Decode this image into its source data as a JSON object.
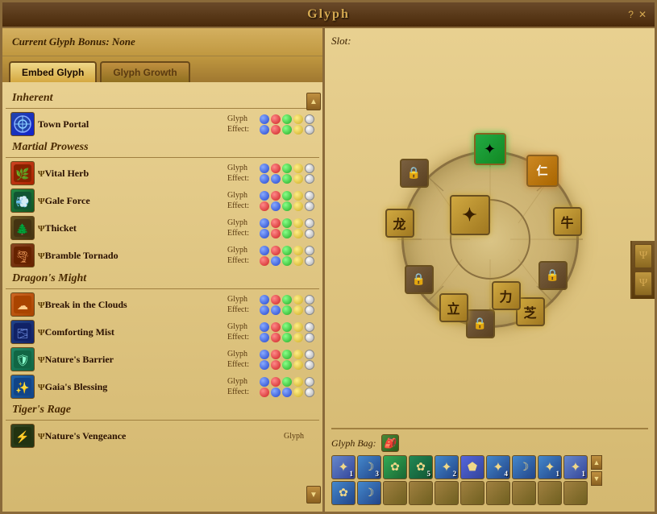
{
  "window": {
    "title": "Glyph",
    "help_btn": "?",
    "close_btn": "✕"
  },
  "header": {
    "bonus_label": "Current Glyph Bonus:",
    "bonus_value": "None",
    "embed_tab": "Embed Glyph",
    "growth_tab": "Glyph Growth"
  },
  "slot_label": "Slot:",
  "bag_label": "Glyph Bag:",
  "sections": [
    {
      "name": "Inherent",
      "items": [
        {
          "name": "Town Portal",
          "icon_class": "icon-town-portal",
          "icon_char": "🌀",
          "psi": false
        }
      ]
    },
    {
      "name": "Martial Prowess",
      "items": [
        {
          "name": "Vital Herb",
          "icon_class": "icon-vital-herb",
          "icon_char": "🌿",
          "psi": true
        },
        {
          "name": "Gale Force",
          "icon_class": "icon-gale-force",
          "icon_char": "💨",
          "psi": true
        },
        {
          "name": "Thicket",
          "icon_class": "icon-thicket",
          "icon_char": "🌲",
          "psi": true
        },
        {
          "name": "Bramble Tornado",
          "icon_class": "icon-bramble",
          "icon_char": "🌪",
          "psi": true
        }
      ]
    },
    {
      "name": "Dragon's Might",
      "items": [
        {
          "name": "Break in the Clouds",
          "icon_class": "icon-break",
          "icon_char": "☁",
          "psi": true
        },
        {
          "name": "Comforting Mist",
          "icon_class": "icon-comforting",
          "icon_char": "🌫",
          "psi": true
        },
        {
          "name": "Nature's Barrier",
          "icon_class": "icon-barrier",
          "icon_char": "🛡",
          "psi": true
        },
        {
          "name": "Gaia's Blessing",
          "icon_class": "icon-gaia",
          "icon_char": "✨",
          "psi": true
        }
      ]
    },
    {
      "name": "Tiger's Rage",
      "items": [
        {
          "name": "Nature's Vengeance",
          "icon_class": "icon-nature-veng",
          "icon_char": "⚡",
          "psi": true
        }
      ]
    }
  ],
  "effect_labels": {
    "glyph": "Glyph",
    "effect": "Effect:"
  },
  "circle_slots": [
    {
      "id": "top",
      "symbol": "✦",
      "locked": false,
      "active": true,
      "color": "green",
      "angle": 270
    },
    {
      "id": "top-right-1",
      "symbol": "仁",
      "locked": false,
      "active": true,
      "color": "orange",
      "angle": 315
    },
    {
      "id": "right-top",
      "symbol": "牛",
      "locked": false,
      "active": true,
      "color": "gold",
      "angle": 0
    },
    {
      "id": "right",
      "symbol": "",
      "locked": true,
      "active": false,
      "angle": 45
    },
    {
      "id": "bottom-right",
      "symbol": "芝",
      "locked": false,
      "active": true,
      "color": "gold",
      "angle": 45
    },
    {
      "id": "bottom-right-2",
      "symbol": "",
      "locked": true,
      "active": false,
      "angle": 90
    },
    {
      "id": "bottom",
      "symbol": "力",
      "locked": false,
      "active": true,
      "color": "gold",
      "angle": 90
    },
    {
      "id": "bottom-left-2",
      "symbol": "立",
      "locked": false,
      "active": true,
      "color": "gold",
      "angle": 135
    },
    {
      "id": "bottom-left",
      "symbol": "",
      "locked": true,
      "active": false,
      "angle": 135
    },
    {
      "id": "left-bottom",
      "symbol": "龙",
      "locked": false,
      "active": true,
      "color": "gold",
      "angle": 180
    },
    {
      "id": "left",
      "symbol": "",
      "locked": true,
      "active": false,
      "angle": 225
    },
    {
      "id": "inner-center",
      "symbol": "✦",
      "locked": false,
      "active": true,
      "angle": 0
    }
  ],
  "bag_items": [
    {
      "color": "#4488cc",
      "count": "1",
      "empty": false
    },
    {
      "color": "#4488cc",
      "count": "3",
      "empty": false
    },
    {
      "color": "#33aa55",
      "count": "",
      "empty": false
    },
    {
      "color": "#33aa55",
      "count": "5",
      "empty": false
    },
    {
      "color": "#4488cc",
      "count": "2",
      "empty": false
    },
    {
      "color": "#5566cc",
      "count": "",
      "empty": false
    },
    {
      "color": "#4488cc",
      "count": "4",
      "empty": false
    },
    {
      "color": "#4488cc",
      "count": "",
      "empty": false
    },
    {
      "color": "#4488cc",
      "count": "1",
      "empty": false
    },
    {
      "color": "#4488cc",
      "count": "1",
      "empty": false
    },
    {
      "color": "#4488cc",
      "count": "",
      "empty": false
    },
    {
      "color": "#4488cc",
      "count": "",
      "empty": false
    },
    {
      "empty": true
    },
    {
      "empty": true
    },
    {
      "empty": true
    },
    {
      "empty": true
    },
    {
      "empty": true
    },
    {
      "empty": true
    },
    {
      "empty": true
    },
    {
      "empty": true
    }
  ]
}
